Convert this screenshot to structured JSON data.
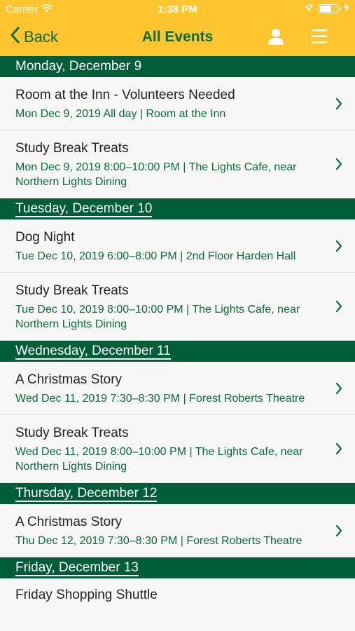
{
  "status_bar": {
    "carrier": "Carrier",
    "time": "1:38 PM"
  },
  "nav": {
    "back_label": "Back",
    "title": "All Events",
    "icons": [
      "user-icon",
      "hamburger-menu-icon"
    ]
  },
  "colors": {
    "header_yellow": "#fec52e",
    "section_green": "#005d39",
    "text_green": "#0b6b3a"
  },
  "days": [
    {
      "header": "Monday, December 9",
      "events": [
        {
          "name": "Room at the Inn - Volunteers Needed",
          "details": "Mon Dec 9, 2019 All day  | Room at the Inn"
        },
        {
          "name": "Study Break Treats",
          "details": "Mon Dec 9, 2019 8:00–10:00 PM  | The Lights Cafe, near Northern Lights Dining"
        }
      ]
    },
    {
      "header": "Tuesday, December 10",
      "events": [
        {
          "name": "Dog Night",
          "details": "Tue Dec 10, 2019 6:00–8:00 PM  | 2nd Floor Harden Hall"
        },
        {
          "name": "Study Break Treats",
          "details": "Tue Dec 10, 2019 8:00–10:00 PM  | The Lights Cafe, near Northern Lights Dining"
        }
      ]
    },
    {
      "header": "Wednesday, December 11",
      "events": [
        {
          "name": "A Christmas Story",
          "details": "Wed Dec 11, 2019 7:30–8:30 PM  | Forest Roberts The­atre"
        },
        {
          "name": "Study Break Treats",
          "details": "Wed Dec 11, 2019 8:00–10:00 PM  | The Lights Cafe, near Northern Lights Dining"
        }
      ]
    },
    {
      "header": "Thursday, December 12",
      "events": [
        {
          "name": "A Christmas Story",
          "details": "Thu Dec 12, 2019 7:30–8:30 PM  | Forest Roberts The­atre"
        }
      ]
    },
    {
      "header": "Friday, December 13",
      "events": [
        {
          "name": "Friday Shopping Shuttle",
          "details": ""
        }
      ]
    }
  ]
}
